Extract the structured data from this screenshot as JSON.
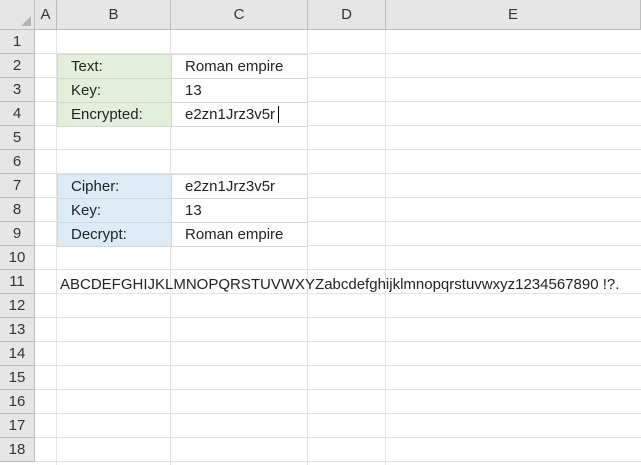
{
  "columns": [
    "A",
    "B",
    "C",
    "D",
    "E"
  ],
  "rows": [
    "1",
    "2",
    "3",
    "4",
    "5",
    "6",
    "7",
    "8",
    "9",
    "10",
    "11",
    "12",
    "13",
    "14",
    "15",
    "16",
    "17",
    "18"
  ],
  "encrypt_table": {
    "text_label": "Text:",
    "text_value": "Roman empire",
    "key_label": "Key:",
    "key_value": "13",
    "encrypted_label": "Encrypted:",
    "encrypted_value": "e2zn1Jrz3v5r"
  },
  "decrypt_table": {
    "cipher_label": "Cipher:",
    "cipher_value": "e2zn1Jrz3v5r",
    "key_label": "Key:",
    "key_value": "13",
    "decrypt_label": "Decrypt:",
    "decrypt_value": "Roman empire"
  },
  "alphabet_row": "ABCDEFGHIJKLMNOPQRSTUVWXYZabcdefghijklmnopqrstuvwxyz1234567890 !?.",
  "colors": {
    "header_bg": "#e6e6e6",
    "label_green": "#e2efda",
    "label_blue": "#ddebf7"
  }
}
